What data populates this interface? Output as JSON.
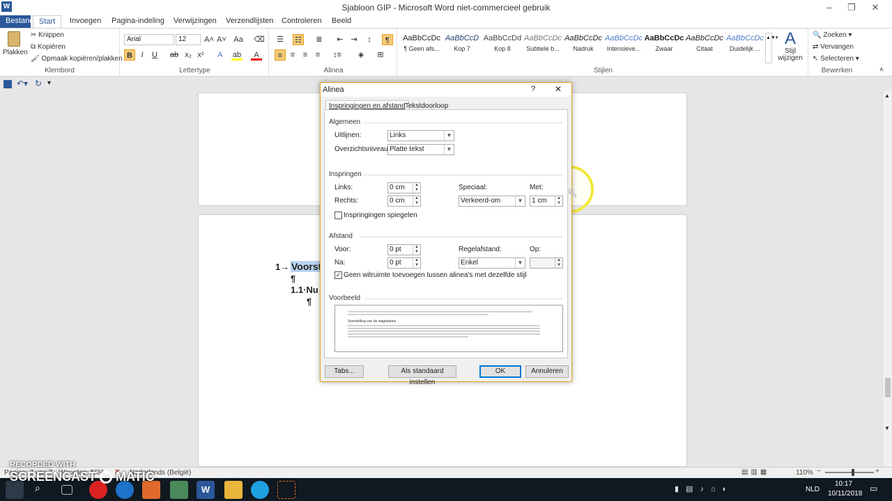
{
  "window": {
    "title": "Sjabloon GIP  -  Microsoft Word niet-commercieel gebruik",
    "app_icon": "W"
  },
  "tabs": [
    "Bestand",
    "Start",
    "Invoegen",
    "Pagina-indeling",
    "Verwijzingen",
    "Verzendlijsten",
    "Controleren",
    "Beeld"
  ],
  "ribbon": {
    "clipboard": {
      "paste": "Plakken",
      "cut": "Knippen",
      "copy": "Kopiëren",
      "format_painter": "Opmaak kopiëren/plakken",
      "group": "Klembord"
    },
    "font": {
      "name": "Arial",
      "size": "12",
      "group": "Lettertype"
    },
    "paragraph": {
      "group": "Alinea"
    },
    "styles": {
      "group": "Stijlen",
      "items": [
        {
          "sample": "AaBbCcDc",
          "name": "¶ Geen afs..."
        },
        {
          "sample": "AaBbCcD",
          "name": "Kop 7"
        },
        {
          "sample": "AaBbCcDd",
          "name": "Kop 8"
        },
        {
          "sample": "AaBbCcDc",
          "name": "Subtiele b..."
        },
        {
          "sample": "AaBbCcDc",
          "name": "Nadruk"
        },
        {
          "sample": "AaBbCcDc",
          "name": "Intensieve..."
        },
        {
          "sample": "AaBbCcDc",
          "name": "Zwaar"
        },
        {
          "sample": "AaBbCcDc",
          "name": "Citaat"
        },
        {
          "sample": "AaBbCcDc",
          "name": "Duidelijk ..."
        }
      ],
      "change": "Stijl wijzigen"
    },
    "editing": {
      "find": "Zoeken",
      "replace": "Vervangen",
      "select": "Selecteren",
      "group": "Bewerken"
    }
  },
  "document": {
    "line1_num": "1→",
    "line1_text": "Voorst",
    "pilcrow": "¶",
    "line2": "1.1·Nu"
  },
  "dialog": {
    "title": "Alinea",
    "help": "?",
    "close": "✕",
    "tabs": [
      "Inspringingen en afstand",
      "Tekstdoorloop"
    ],
    "general": {
      "section": "Algemeen",
      "alignment_label": "Uitlijnen:",
      "alignment_value": "Links",
      "outline_label": "Overzichtsniveau:",
      "outline_value": "Platte tekst"
    },
    "indent": {
      "section": "Inspringen",
      "left_label": "Links:",
      "left_value": "0 cm",
      "right_label": "Rechts:",
      "right_value": "0 cm",
      "special_label": "Speciaal:",
      "special_value": "Verkeerd-om",
      "by_label": "Met:",
      "by_value": "1 cm",
      "mirror_label": "Inspringingen spiegelen"
    },
    "spacing": {
      "section": "Afstand",
      "before_label": "Voor:",
      "before_value": "0 pt",
      "after_label": "Na:",
      "after_value": "0 pt",
      "line_label": "Regelafstand:",
      "line_value": "Enkel",
      "at_label": "Op:",
      "at_value": "",
      "no_space_label": "Geen witruimte toevoegen tussen alinea's met dezelfde stijl"
    },
    "preview": {
      "section": "Voorbeeld",
      "sample_text": "Voorstelling van de stageplaats"
    },
    "buttons": {
      "tabs": "Tabs...",
      "default": "Als standaard instellen",
      "ok": "OK",
      "cancel": "Annuleren"
    }
  },
  "status": {
    "page": "Pagina: 7 van 7",
    "words": "Woorden: 5/36",
    "language": "Nederlands (België)",
    "zoom": "110%"
  },
  "taskbar": {
    "lang": "NLD",
    "time": "10:17",
    "date": "10/11/2018"
  },
  "watermark": {
    "line1": "RECORDED WITH",
    "line2": "SCREENCAST",
    "line3": "MATIC"
  }
}
